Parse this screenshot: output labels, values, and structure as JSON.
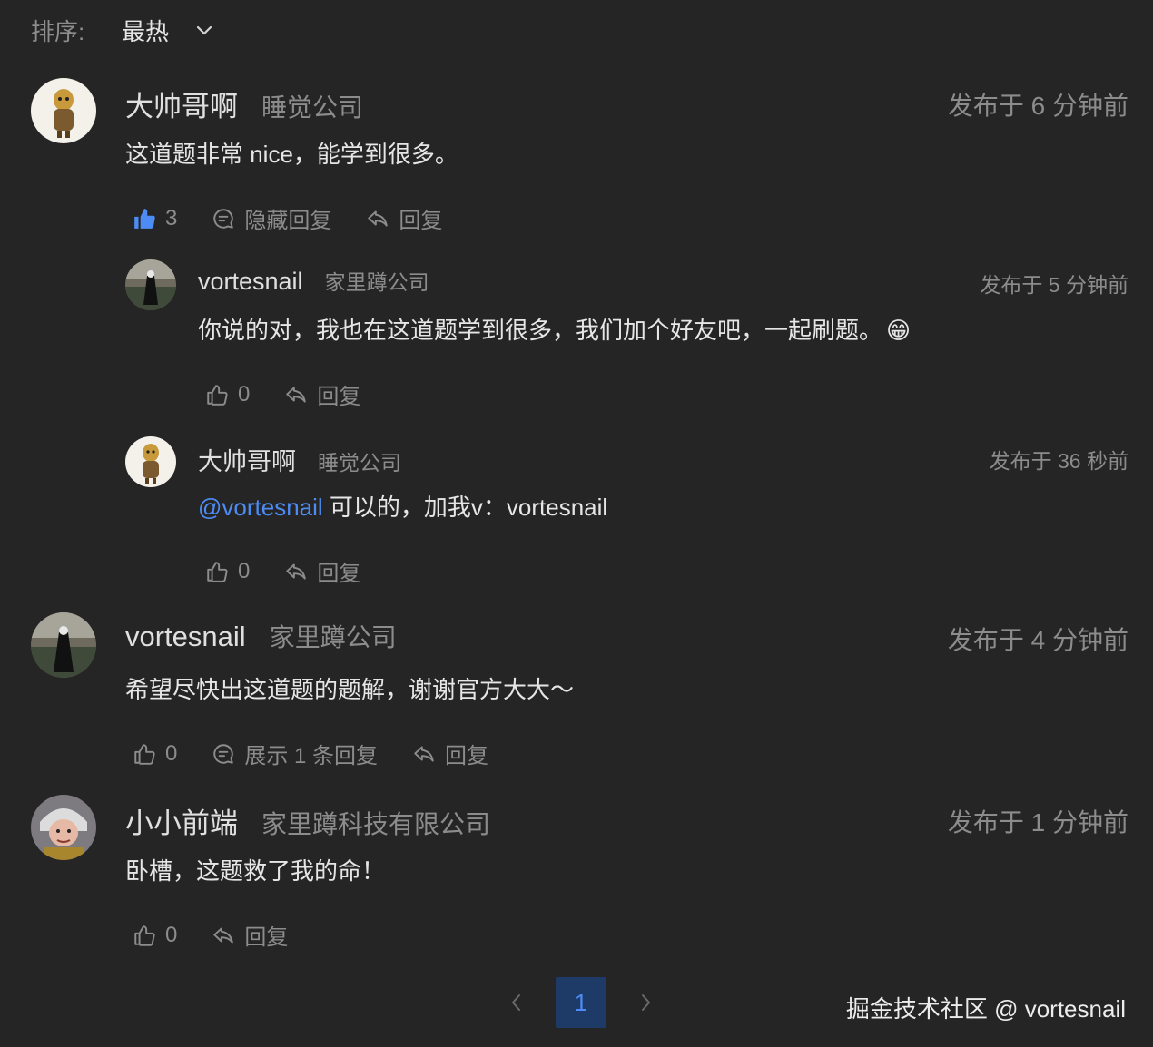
{
  "sort": {
    "label": "排序:",
    "value": "最热"
  },
  "comments": [
    {
      "user": "大帅哥啊",
      "company": "睡觉公司",
      "time": "发布于 6 分钟前",
      "text": "这道题非常 nice，能学到很多。",
      "likes": "3",
      "toggle_label": "隐藏回复",
      "reply_label": "回复",
      "replies": [
        {
          "user": "vortesnail",
          "company": "家里蹲公司",
          "time": "发布于 5 分钟前",
          "text": "你说的对，我也在这道题学到很多，我们加个好友吧，一起刷题。",
          "emoji": "😁",
          "likes": "0",
          "reply_label": "回复"
        },
        {
          "user": "大帅哥啊",
          "company": "睡觉公司",
          "time": "发布于 36 秒前",
          "mention": "@vortesnail",
          "text": " 可以的，加我v：vortesnail",
          "likes": "0",
          "reply_label": "回复"
        }
      ]
    },
    {
      "user": "vortesnail",
      "company": "家里蹲公司",
      "time": "发布于 4 分钟前",
      "text": "希望尽快出这道题的题解，谢谢官方大大～",
      "likes": "0",
      "toggle_label": "展示 1 条回复",
      "reply_label": "回复"
    },
    {
      "user": "小小前端",
      "company": "家里蹲科技有限公司",
      "time": "发布于 1 分钟前",
      "text": "卧槽，这题救了我的命！",
      "likes": "0",
      "reply_label": "回复"
    }
  ],
  "pagination": {
    "current": "1"
  },
  "watermark": "掘金技术社区 @ vortesnail",
  "colors": {
    "background": "#252526",
    "accent": "#4d8cf5",
    "page_active_bg": "#1e3a66",
    "muted": "#8c8c8c"
  }
}
